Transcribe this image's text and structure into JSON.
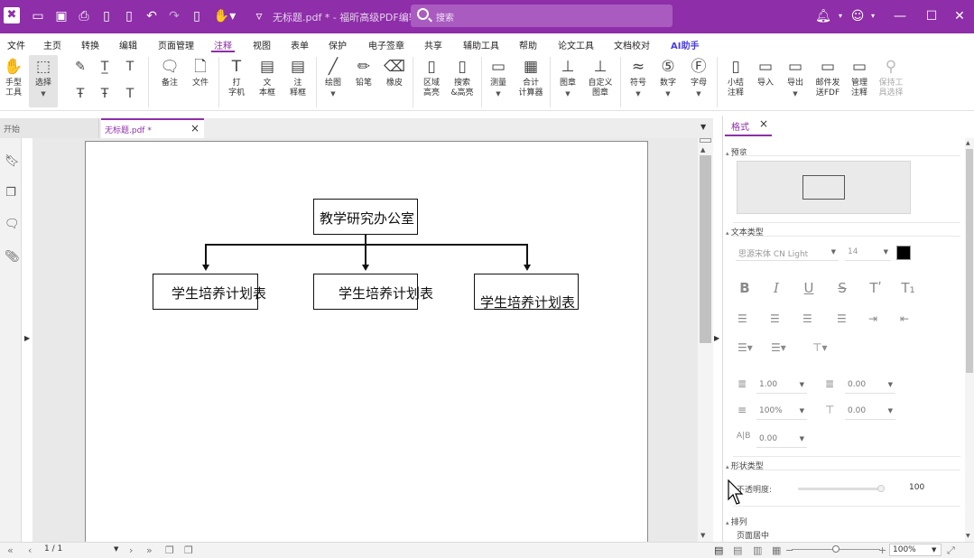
{
  "app": {
    "doc_title": "无标题.pdf * - 福昕高级PDF编辑器",
    "search_placeholder": "搜索"
  },
  "menu": [
    "文件",
    "主页",
    "转换",
    "编辑",
    "页面管理",
    "注释",
    "视图",
    "表单",
    "保护",
    "电子签章",
    "共享",
    "辅助工具",
    "帮助",
    "论文工具",
    "文档校对",
    "AI助手"
  ],
  "menu_active": "注释",
  "ribbon": {
    "hand": "手型\n工具",
    "select": "选择",
    "note": "备注",
    "file": "文件",
    "typewriter": "打\n字机",
    "textbox": "文\n本框",
    "callout": "注\n释框",
    "drawing": "绘图",
    "pencil": "铅笔",
    "eraser": "橡皮",
    "area_highlight": "区域\n高亮",
    "search_highlight": "搜索\n&高亮",
    "measure": "测量",
    "calculator": "合计\n计算器",
    "stamp": "图章",
    "custom_stamp": "自定义\n图章",
    "symbol": "符号",
    "number": "数字",
    "letter": "字母",
    "summary": "小结\n注释",
    "import": "导入",
    "export": "导出",
    "email_fdf": "邮件发\n送FDF",
    "manage": "管理\n注释",
    "keep_tool": "保持工\n具选择"
  },
  "tabs": {
    "home": "开始",
    "doc": "无标题.pdf *"
  },
  "diagram": {
    "root": "教学研究办公室",
    "children": [
      "学生培养计划表",
      "学生培养计划表",
      "学生培养计划表"
    ]
  },
  "panel": {
    "tab": "格式",
    "preview_section": "预览",
    "text_type_section": "文本类型",
    "font_name": "思源宋体 CN Light",
    "font_size": "14",
    "text_color": "#000000",
    "line_spacing": "1.00",
    "para_spacing": "0.00",
    "horizontal_scale": "100%",
    "baseline_offset": "0.00",
    "char_spacing": "0.00",
    "shape_type_section": "形状类型",
    "opacity_label": "不透明度:",
    "opacity_value": "100",
    "arrange_section": "排列",
    "page_center": "页面居中"
  },
  "status": {
    "page": "1 / 1",
    "zoom": "100%"
  },
  "colors": {
    "brand": "#8e2ea8",
    "ai": "#4a3de0"
  }
}
